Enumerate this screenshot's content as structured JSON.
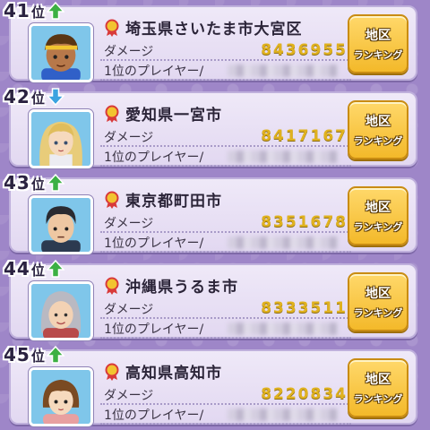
{
  "rows": [
    {
      "rank_num": "41",
      "rank_suffix": "位",
      "trend": "up",
      "location": "埼玉県さいたま市大宮区",
      "damage_label": "ダメージ",
      "damage": "8436955",
      "player_label": "1位のプレイヤー/",
      "button_top": "地区",
      "button_bottom": "ランキング",
      "avatar": "boy-brown-hair-headband-icon"
    },
    {
      "rank_num": "42",
      "rank_suffix": "位",
      "trend": "down",
      "location": "愛知県一宮市",
      "damage_label": "ダメージ",
      "damage": "8417167",
      "player_label": "1位のプレイヤー/",
      "button_top": "地区",
      "button_bottom": "ランキング",
      "avatar": "girl-blonde-hair-icon"
    },
    {
      "rank_num": "43",
      "rank_suffix": "位",
      "trend": "up",
      "location": "東京都町田市",
      "damage_label": "ダメージ",
      "damage": "8351678",
      "player_label": "1位のプレイヤー/",
      "button_top": "地区",
      "button_bottom": "ランキング",
      "avatar": "man-dark-hair-icon"
    },
    {
      "rank_num": "44",
      "rank_suffix": "位",
      "trend": "up",
      "location": "沖縄県うるま市",
      "damage_label": "ダメージ",
      "damage": "8333511",
      "player_label": "1位のプレイヤー/",
      "button_top": "地区",
      "button_bottom": "ランキング",
      "avatar": "grandmother-gray-hair-icon"
    },
    {
      "rank_num": "45",
      "rank_suffix": "位",
      "trend": "up",
      "location": "高知県高知市",
      "damage_label": "ダメージ",
      "damage": "8220834",
      "player_label": "1位のプレイヤー/",
      "button_top": "地区",
      "button_bottom": "ランキング",
      "avatar": "child-bob-hair-icon"
    }
  ],
  "colors": {
    "background": "#9e86c8",
    "damage_text": "#e0b21f",
    "button": "#f3b92a",
    "trend_up": "#3cb043",
    "trend_down": "#3aa3e0",
    "avatar_bg": "#7fc6ea"
  }
}
